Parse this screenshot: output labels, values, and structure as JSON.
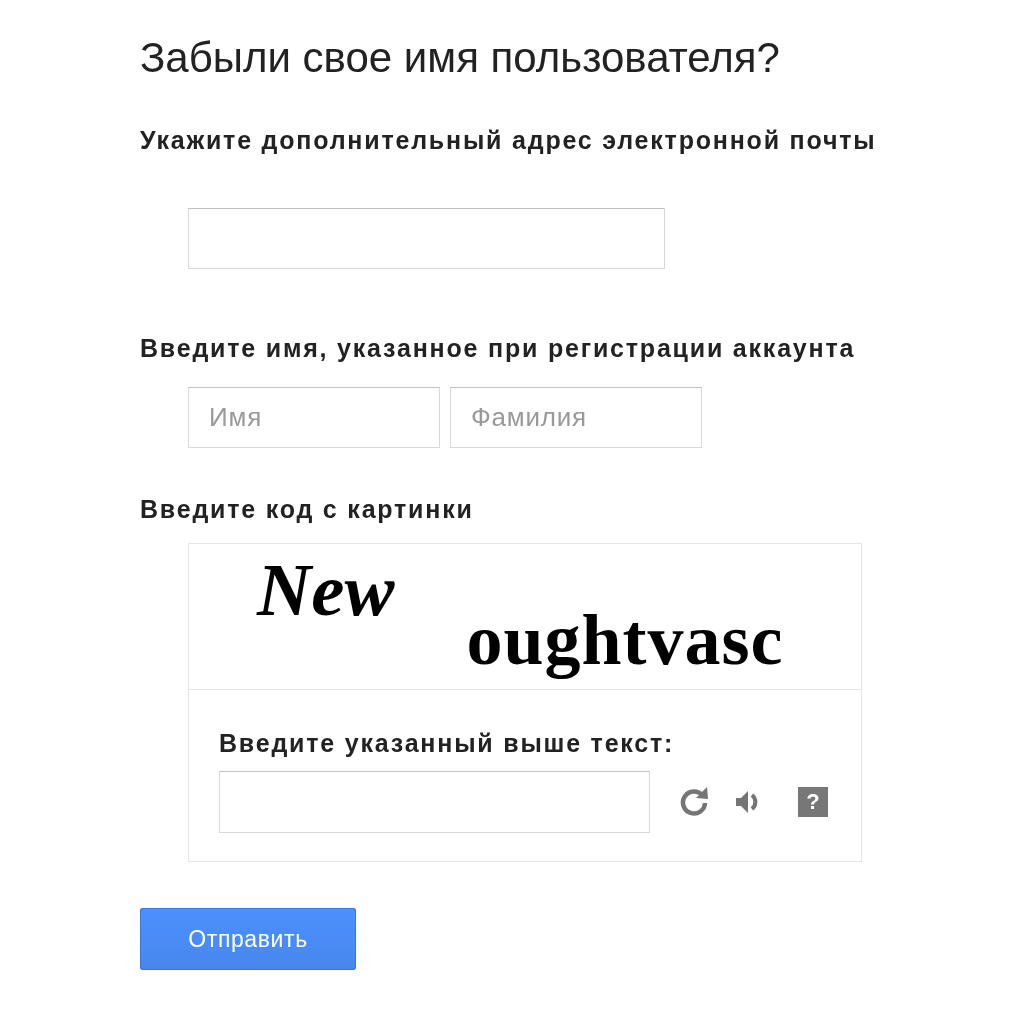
{
  "title": "Забыли свое имя пользователя?",
  "email": {
    "label": "Укажите дополнительный адрес электронной почты"
  },
  "name": {
    "label": "Введите имя, указанное при регистрации аккаунта",
    "fields": [
      {
        "placeholder": "Имя"
      },
      {
        "placeholder": "Фамилия"
      }
    ]
  },
  "captcha": {
    "label": "Введите код с картинки",
    "words": [
      "New",
      "oughtvasc"
    ],
    "prompt": "Введите указанный выше текст:",
    "help_button": "?"
  },
  "submit_button": "Отправить"
}
